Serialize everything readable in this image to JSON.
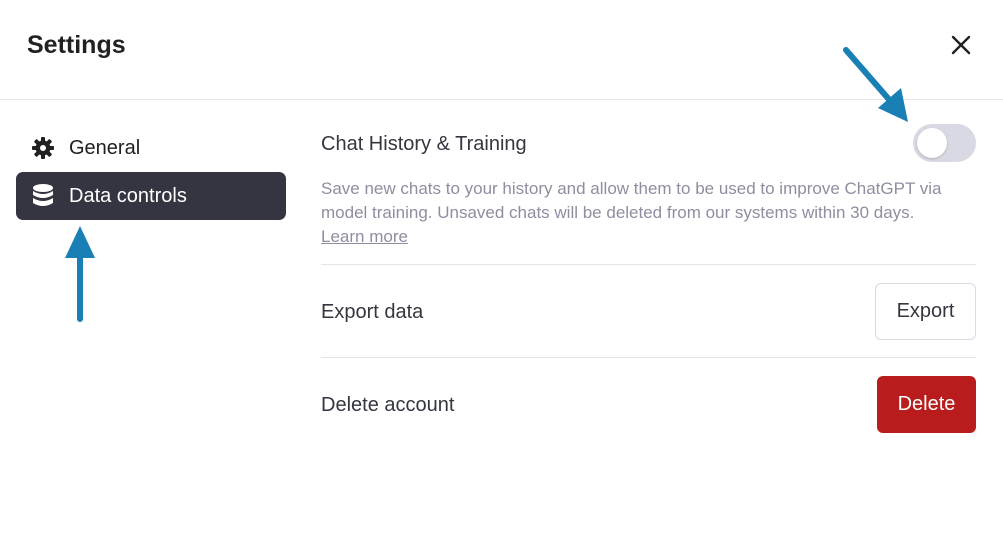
{
  "dialog": {
    "title": "Settings",
    "close_icon": "close-icon"
  },
  "sidebar": {
    "items": [
      {
        "label": "General",
        "icon": "gear-icon",
        "active": false
      },
      {
        "label": "Data controls",
        "icon": "database-icon",
        "active": true
      }
    ]
  },
  "data_controls": {
    "history": {
      "label": "Chat History & Training",
      "enabled": false,
      "description": "Save new chats to your history and allow them to be used to improve ChatGPT via model training. Unsaved chats will be deleted from our systems within 30 days.",
      "learn_more": "Learn more"
    },
    "export": {
      "label": "Export data",
      "button": "Export"
    },
    "delete": {
      "label": "Delete account",
      "button": "Delete"
    }
  },
  "colors": {
    "active_nav_bg": "#343541",
    "delete_button_bg": "#b91c1c",
    "toggle_off_bg": "#d9d9e3",
    "annotation_arrow": "#1a7fb5"
  }
}
